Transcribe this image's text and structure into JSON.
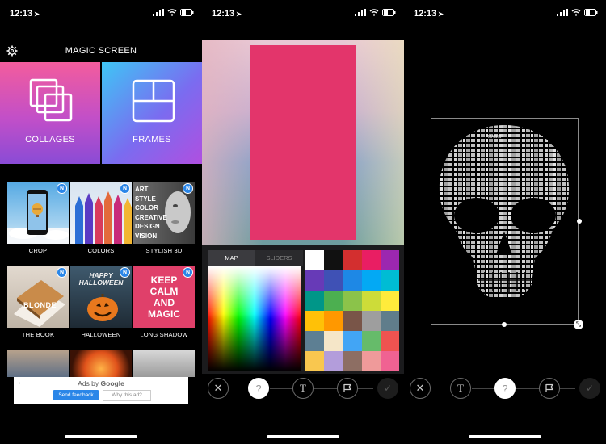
{
  "status": [
    {
      "time": "12:13"
    },
    {
      "time": "12:13"
    },
    {
      "time": "12:13"
    }
  ],
  "screen1": {
    "title": "MAGIC SCREEN",
    "collages_label": "COLLAGES",
    "frames_label": "FRAMES",
    "badge": "N",
    "grid": [
      {
        "caption": "CROP"
      },
      {
        "caption": "COLORS"
      },
      {
        "caption": "STYLISH 3D",
        "art_lines": [
          "ART",
          "STYLE",
          "COLOR",
          "CREATIVE",
          "DESIGN",
          "VISION"
        ]
      },
      {
        "caption": "THE BOOK",
        "cover_text": "BLONDE"
      },
      {
        "caption": "HALLOWEEN",
        "cover_text": "HAPPY HALLOWEEN"
      },
      {
        "caption": "LONG SHADOW",
        "cover_lines": [
          "KEEP",
          "CALM",
          "AND",
          "MAGIC"
        ]
      }
    ],
    "ad": {
      "title_prefix": "Ads by",
      "title_brand": "Google",
      "feedback": "Send feedback",
      "why": "Why this ad?"
    }
  },
  "screen2": {
    "tabs": [
      "MAP",
      "SLIDERS"
    ],
    "active_tab": "MAP",
    "fill_color": "#e3356b",
    "swatches": [
      "#ffffff",
      "#111111",
      "#d32f2f",
      "#e91e63",
      "#9c27b0",
      "#673ab7",
      "#3f51b5",
      "#1e88e5",
      "#03a9f4",
      "#00bcd4",
      "#009688",
      "#4caf50",
      "#8bc34a",
      "#cddc39",
      "#ffeb3b",
      "#ffc107",
      "#ff9800",
      "#795548",
      "#9e9e9e",
      "#607d8b",
      "#5d7f93",
      "#f5e6c8",
      "#42a5f5",
      "#66bb6a",
      "#ef5350",
      "#f9c74f",
      "#b39ddb",
      "#8d6e63",
      "#ef9a9a",
      "#f06292"
    ]
  },
  "screen3": {
    "art_word": "MAGIC"
  }
}
